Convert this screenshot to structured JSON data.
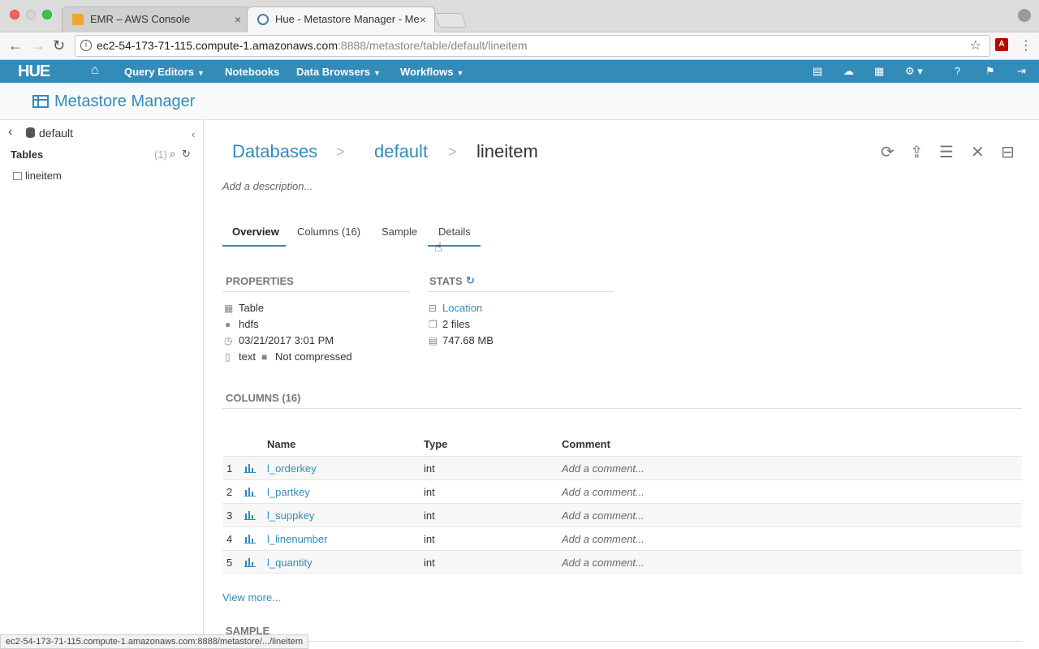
{
  "browser": {
    "tabs": [
      {
        "title": "EMR – AWS Console"
      },
      {
        "title": "Hue - Metastore Manager - Me"
      }
    ],
    "url_host": "ec2-54-173-71-115.compute-1.amazonaws.com",
    "url_rest": ":8888/metastore/table/default/lineitem",
    "status_url": "ec2-54-173-71-115.compute-1.amazonaws.com:8888/metastore/.../lineitem"
  },
  "huenav": {
    "logo": "HUE",
    "items": [
      "Query Editors",
      "Notebooks",
      "Data Browsers",
      "Workflows"
    ]
  },
  "page": {
    "title": "Metastore Manager"
  },
  "sidebar": {
    "database": "default",
    "tables_label": "Tables",
    "tables_count": "(1)",
    "tables": [
      "lineitem"
    ]
  },
  "breadcrumb": {
    "databases": "Databases",
    "sep": ">",
    "db": "default",
    "table": "lineitem"
  },
  "description_placeholder": "Add a description...",
  "tabs": [
    "Overview",
    "Columns (16)",
    "Sample",
    "Details"
  ],
  "properties": {
    "header": "PROPERTIES",
    "type": "Table",
    "owner": "hdfs",
    "created": "03/21/2017 3:01 PM",
    "format": "text",
    "compression": "Not compressed"
  },
  "stats": {
    "header": "STATS",
    "location": "Location",
    "files": "2 files",
    "size": "747.68 MB"
  },
  "columns_section": {
    "header": "COLUMNS (16)",
    "headers": [
      "Name",
      "Type",
      "Comment"
    ],
    "rows": [
      {
        "num": "1",
        "name": "l_orderkey",
        "type": "int",
        "comment": "Add a comment..."
      },
      {
        "num": "2",
        "name": "l_partkey",
        "type": "int",
        "comment": "Add a comment..."
      },
      {
        "num": "3",
        "name": "l_suppkey",
        "type": "int",
        "comment": "Add a comment..."
      },
      {
        "num": "4",
        "name": "l_linenumber",
        "type": "int",
        "comment": "Add a comment..."
      },
      {
        "num": "5",
        "name": "l_quantity",
        "type": "int",
        "comment": "Add a comment..."
      }
    ],
    "view_more": "View more..."
  },
  "sample_section": {
    "header": "SAMPLE"
  },
  "colors": {
    "accent": "#338bb8"
  }
}
